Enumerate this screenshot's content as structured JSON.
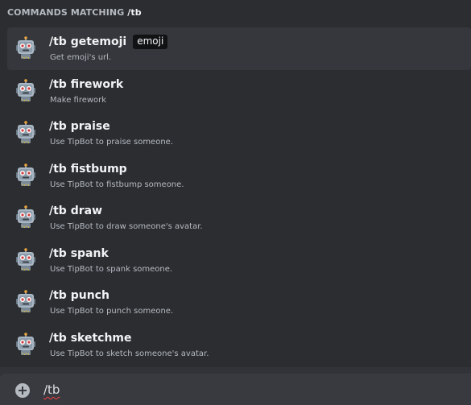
{
  "popup": {
    "header_prefix": "Commands matching",
    "header_query": "/tb"
  },
  "commands": [
    {
      "name": "/tb getemoji",
      "tag": "emoji",
      "description": "Get emoji's url."
    },
    {
      "name": "/tb firework",
      "description": "Make firework"
    },
    {
      "name": "/tb praise",
      "description": "Use TipBot to praise someone."
    },
    {
      "name": "/tb fistbump",
      "description": "Use TipBot to fistbump someone."
    },
    {
      "name": "/tb draw",
      "description": "Use TipBot to draw someone's avatar."
    },
    {
      "name": "/tb spank",
      "description": "Use TipBot to spank someone."
    },
    {
      "name": "/tb punch",
      "description": "Use TipBot to punch someone."
    },
    {
      "name": "/tb sketchme",
      "description": "Use TipBot to sketch someone's avatar."
    }
  ],
  "input": {
    "value": "/tb"
  },
  "icons": {
    "avatar": "tipbot-robot-avatar-icon",
    "add": "plus-circle-icon"
  },
  "colors": {
    "popup_bg": "#2b2d31",
    "selected_bg": "#35373c",
    "input_bg": "#383a40",
    "text_primary": "#f2f3f5",
    "text_muted": "#b5bac1"
  }
}
